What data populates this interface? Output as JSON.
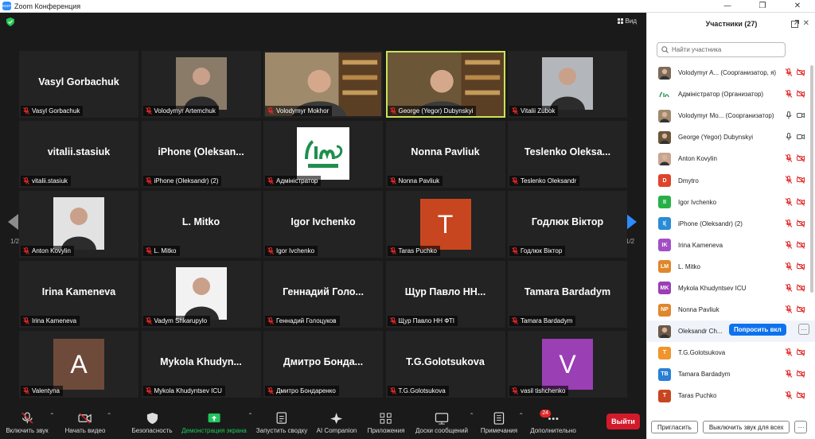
{
  "window": {
    "title": "Zoom Конференция",
    "logo": "zoom"
  },
  "meeting": {
    "view_label": "Вид",
    "page": "1/2",
    "tiles": [
      {
        "name": "Vasyl Gorbachuk",
        "label": "Vasyl Gorbachuk",
        "kind": "text"
      },
      {
        "name": "",
        "label": "Volodymyr Artemchuk",
        "kind": "photo",
        "color": "#8a7a68"
      },
      {
        "name": "",
        "label": "Volodymyr Mokhor",
        "kind": "video",
        "color": "#a08a6c"
      },
      {
        "name": "",
        "label": "George (Yegor) Dubynskyi",
        "kind": "video",
        "color": "#6b5638",
        "active": true
      },
      {
        "name": "",
        "label": "Vitalii Zubok",
        "kind": "photo",
        "color": "#b3b7bc"
      },
      {
        "name": "vitalii.stasiuk",
        "label": "vitalii.stasiuk",
        "kind": "text"
      },
      {
        "name": "iPhone  (Oleksan...",
        "label": "iPhone (Oleksandr) (2)",
        "kind": "text"
      },
      {
        "name": "",
        "label": "Адміністратор",
        "kind": "logo"
      },
      {
        "name": "Nonna Pavliuk",
        "label": "Nonna Pavliuk",
        "kind": "text"
      },
      {
        "name": "Teslenko  Oleksa...",
        "label": "Teslenko Oleksandr",
        "kind": "text"
      },
      {
        "name": "",
        "label": "Anton Kovylin",
        "kind": "photo",
        "color": "#e2e2e2"
      },
      {
        "name": "L. Mitko",
        "label": "L. Mitko",
        "kind": "text"
      },
      {
        "name": "Igor Ivchenko",
        "label": "Igor Ivchenko",
        "kind": "text"
      },
      {
        "name": "",
        "label": "Taras Puchko",
        "kind": "avatar",
        "letter": "T",
        "color": "#c8461f"
      },
      {
        "name": "Годлюк Віктор",
        "label": "Годлюк Віктор",
        "kind": "text"
      },
      {
        "name": "Irina Kameneva",
        "label": "Irina Kameneva",
        "kind": "text"
      },
      {
        "name": "",
        "label": "Vadym Shkarupylo",
        "kind": "photo",
        "color": "#f2f2f2"
      },
      {
        "name": "Геннадий  Голо...",
        "label": "Геннадий Голоцуков",
        "kind": "text"
      },
      {
        "name": "Щур  Павло  НН...",
        "label": "Щур Павло НН ФТІ",
        "kind": "text"
      },
      {
        "name": "Tamara Bardadym",
        "label": "Tamara Bardadym",
        "kind": "text"
      },
      {
        "name": "",
        "label": "Valentyna",
        "kind": "avatar",
        "letter": "A",
        "color": "#6e4a3b"
      },
      {
        "name": "Mykola  Khudyn...",
        "label": "Mykola Khudyntsev ICU",
        "kind": "text"
      },
      {
        "name": "Дмитро  Бонда...",
        "label": "Дмитро Бондаренко",
        "kind": "text"
      },
      {
        "name": "T.G.Golotsukova",
        "label": "T.G.Golotsukova",
        "kind": "text"
      },
      {
        "name": "",
        "label": "vasil tishchenko",
        "kind": "avatar",
        "letter": "V",
        "color": "#9b3fb5"
      }
    ]
  },
  "toolbar": {
    "items": [
      {
        "label": "Включить звук",
        "icon": "mic-off-icon",
        "caret": true
      },
      {
        "label": "Начать видео",
        "icon": "video-off-icon",
        "caret": true
      },
      {
        "label": "Безопасность",
        "icon": "shield-icon"
      },
      {
        "label": "Демонстрация экрана",
        "icon": "share-screen-icon",
        "caret": true,
        "accent": true
      },
      {
        "label": "Запустить сводку",
        "icon": "summary-icon"
      },
      {
        "label": "AI Companion",
        "icon": "ai-sparkle-icon"
      },
      {
        "label": "Приложения",
        "icon": "apps-icon"
      },
      {
        "label": "Доски сообщений",
        "icon": "whiteboard-icon",
        "caret": true
      },
      {
        "label": "Примечания",
        "icon": "notes-icon",
        "caret": true
      },
      {
        "label": "Дополнительно",
        "icon": "more-icon",
        "badge": "24"
      }
    ],
    "leave_label": "Выйти"
  },
  "panel": {
    "title": "Участники (27)",
    "search_placeholder": "Найти участника",
    "participants": [
      {
        "name": "Volodymyr A... (Соорганизатор, я)",
        "initials": "",
        "color": "#7d6a58",
        "photo": true,
        "mic": "off",
        "video": "off"
      },
      {
        "name": "Адміністратор (Организатор)",
        "initials": "",
        "color": "#ffffff",
        "logo": true,
        "mic": "off",
        "video": "off"
      },
      {
        "name": "Volodymyr Mo...  (Соорганизатор)",
        "initials": "",
        "color": "#a08a6c",
        "photo": true,
        "mic": "on",
        "video": "on"
      },
      {
        "name": "George (Yegor) Dubynskyi",
        "initials": "",
        "color": "#6b5638",
        "photo": true,
        "mic": "on",
        "video": "on"
      },
      {
        "name": "Anton Kovylin",
        "initials": "",
        "color": "#c9a490",
        "photo": true,
        "mic": "off",
        "video": "off"
      },
      {
        "name": "Dmytro",
        "initials": "D",
        "color": "#e0432b",
        "mic": "off",
        "video": "off"
      },
      {
        "name": "Igor Ivchenko",
        "initials": "II",
        "color": "#27b048",
        "mic": "off",
        "video": "off"
      },
      {
        "name": "iPhone (Oleksandr) (2)",
        "initials": "I(",
        "color": "#2a8bd6",
        "mic": "off",
        "video": "off"
      },
      {
        "name": "Irina Kameneva",
        "initials": "IK",
        "color": "#a24fc6",
        "mic": "off",
        "video": "off"
      },
      {
        "name": "L. Mitko",
        "initials": "LM",
        "color": "#e0862b",
        "mic": "off",
        "video": "off"
      },
      {
        "name": "Mykola Khudyntsev ICU",
        "initials": "MK",
        "color": "#9b3fb5",
        "mic": "off",
        "video": "off"
      },
      {
        "name": "Nonna Pavliuk",
        "initials": "NP",
        "color": "#e0862b",
        "mic": "off",
        "video": "off"
      },
      {
        "name": "Oleksandr Ch...",
        "initials": "",
        "color": "#6b5a4a",
        "photo": true,
        "ask": true,
        "mic": "off",
        "video": "off"
      },
      {
        "name": "T.G.Golotsukova",
        "initials": "T",
        "color": "#f0952b",
        "mic": "off",
        "video": "off"
      },
      {
        "name": "Tamara Bardadym",
        "initials": "TB",
        "color": "#2a7fd6",
        "mic": "off",
        "video": "off"
      },
      {
        "name": "Taras Puchko",
        "initials": "T",
        "color": "#c8461f",
        "mic": "off",
        "video": "off"
      }
    ],
    "ask_label": "Попросить вкл",
    "more_label": "···",
    "invite_label": "Пригласить",
    "mute_all_label": "Выключить звук для всех",
    "footer_more_label": "···"
  },
  "colors": {
    "accent": "#c8e35a",
    "share": "#22c55e",
    "leave": "#d31a2b",
    "muted": "#e02828",
    "blue": "#0e72ed"
  }
}
